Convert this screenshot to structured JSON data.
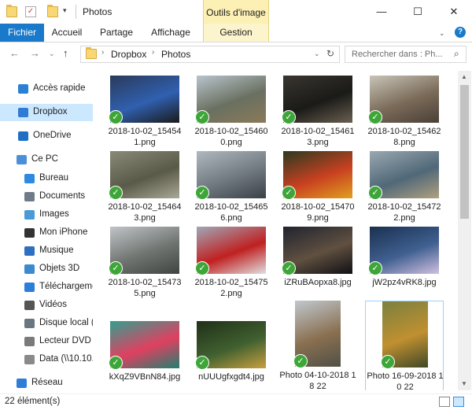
{
  "window": {
    "title": "Photos",
    "contextual_tab_group": "Outils d'image",
    "minimize": "—",
    "maximize": "☐",
    "close": "✕"
  },
  "ribbon": {
    "tabs": [
      "Fichier",
      "Accueil",
      "Partage",
      "Affichage",
      "Gestion"
    ],
    "help": "?"
  },
  "address": {
    "breadcrumb": [
      "Dropbox",
      "Photos"
    ],
    "search_placeholder": "Rechercher dans : Ph..."
  },
  "sidebar": {
    "items": [
      {
        "label": "Accès rapide",
        "icon": "star-icon"
      },
      {
        "label": "Dropbox",
        "icon": "dropbox-icon",
        "selected": true
      },
      {
        "label": "OneDrive",
        "icon": "cloud-icon"
      },
      {
        "label": "Ce PC",
        "icon": "computer-icon"
      },
      {
        "label": "Bureau",
        "icon": "desktop-icon"
      },
      {
        "label": "Documents",
        "icon": "documents-icon"
      },
      {
        "label": "Images",
        "icon": "images-icon"
      },
      {
        "label": "Mon iPhone",
        "icon": "phone-icon"
      },
      {
        "label": "Musique",
        "icon": "music-icon"
      },
      {
        "label": "Objets 3D",
        "icon": "cube-icon"
      },
      {
        "label": "Téléchargements",
        "icon": "download-icon"
      },
      {
        "label": "Vidéos",
        "icon": "video-icon"
      },
      {
        "label": "Disque local (C:)",
        "icon": "drive-icon"
      },
      {
        "label": "Lecteur DVD (D:)",
        "icon": "dvd-icon"
      },
      {
        "label": "Data (\\\\10.10.",
        "icon": "network-drive-icon"
      },
      {
        "label": "Réseau",
        "icon": "network-icon"
      }
    ]
  },
  "files": [
    {
      "name": "2018-10-02_154541.png",
      "colors": [
        "#2a3a5a",
        "#3060b0",
        "#1a1a1a"
      ]
    },
    {
      "name": "2018-10-02_154600.png",
      "colors": [
        "#b8c4cc",
        "#6a7060",
        "#8a7a5a"
      ]
    },
    {
      "name": "2018-10-02_154613.png",
      "colors": [
        "#3a3630",
        "#1a1a18",
        "#6a6050"
      ]
    },
    {
      "name": "2018-10-02_154628.png",
      "colors": [
        "#c8c4b8",
        "#7a6a58",
        "#4a4038"
      ]
    },
    {
      "name": "2018-10-02_154643.png",
      "colors": [
        "#8a8a78",
        "#5a5a48",
        "#aaa898"
      ]
    },
    {
      "name": "2018-10-02_154656.png",
      "colors": [
        "#b0b8c0",
        "#707880",
        "#3a4048"
      ]
    },
    {
      "name": "2018-10-02_154709.png",
      "colors": [
        "#2a3a20",
        "#c84020",
        "#e0a020"
      ]
    },
    {
      "name": "2018-10-02_154722.png",
      "colors": [
        "#9aa8b0",
        "#506878",
        "#b0a080"
      ]
    },
    {
      "name": "2018-10-02_154735.png",
      "colors": [
        "#c0c4c8",
        "#707470",
        "#404440"
      ]
    },
    {
      "name": "2018-10-02_154752.png",
      "colors": [
        "#a0a8b8",
        "#c02020",
        "#e0e0e0"
      ]
    },
    {
      "name": "iZRuBAopxa8.jpg",
      "colors": [
        "#202430",
        "#605040",
        "#101014"
      ]
    },
    {
      "name": "jW2pz4vRK8.jpg",
      "colors": [
        "#1a3050",
        "#406090",
        "#d0c0e0"
      ]
    },
    {
      "name": "kXqZ9VBnN84.jpg",
      "colors": [
        "#30a090",
        "#e04060",
        "#208070"
      ]
    },
    {
      "name": "nUUUgfxgdt4.jpg",
      "colors": [
        "#203018",
        "#406030",
        "#c8a040"
      ]
    },
    {
      "name": "Photo 04-10-2018 18 22",
      "colors": [
        "#c0c8d0",
        "#8a7050",
        "#505048"
      ],
      "portrait": true
    },
    {
      "name": "Photo 16-09-2018 10 22",
      "colors": [
        "#7a8040",
        "#c09030",
        "#404828"
      ],
      "portrait": true,
      "selected": true
    }
  ],
  "status": {
    "count_text": "22 élément(s)"
  }
}
